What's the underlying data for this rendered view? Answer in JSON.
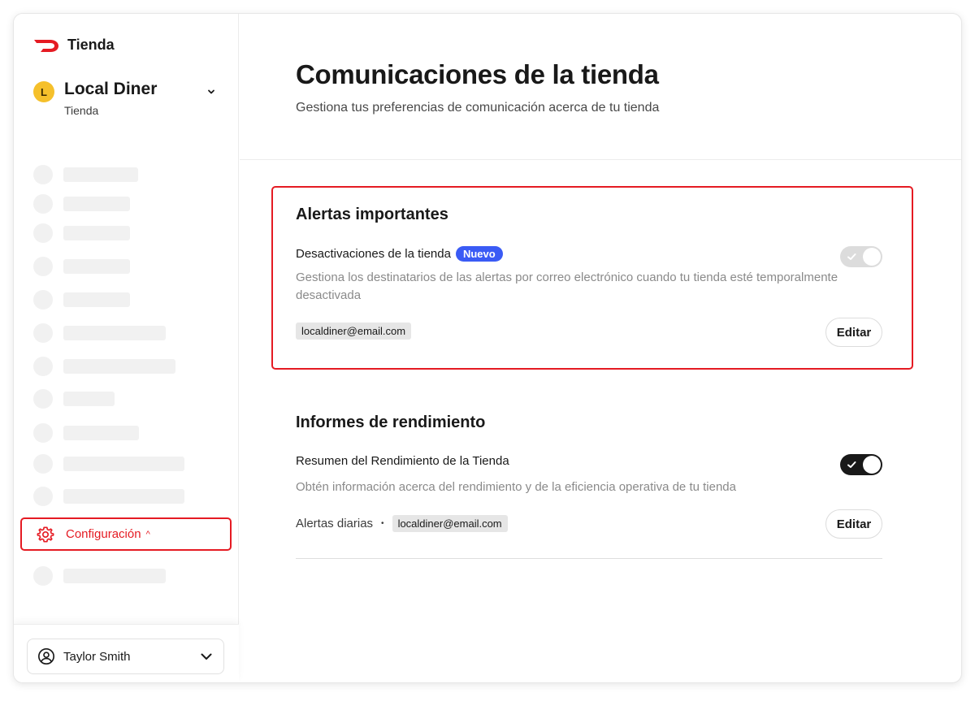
{
  "sidebar": {
    "brand": "Tienda",
    "store": {
      "avatar_letter": "L",
      "name": "Local Diner",
      "type": "Tienda"
    },
    "config_item": {
      "label": "Configuración",
      "caret": "^"
    },
    "user": {
      "name": "Taylor Smith"
    }
  },
  "page": {
    "title": "Comunicaciones de la tienda",
    "subtitle": "Gestiona tus preferencias de comunicación acerca de tu tienda"
  },
  "sections": {
    "alerts": {
      "title": "Alertas importantes",
      "item_title": "Desactivaciones de la tienda",
      "badge": "Nuevo",
      "description": "Gestiona los destinatarios de las alertas por correo electrónico cuando tu tienda esté temporalmente desactivada",
      "email": "localdiner@email.com",
      "edit_label": "Editar"
    },
    "reports": {
      "title": "Informes de rendimiento",
      "item_title": "Resumen del Rendimiento de la Tienda",
      "description": "Obtén información acerca del rendimiento y de la eficiencia operativa de tu tienda",
      "frequency": "Alertas diarias",
      "separator": "•",
      "email": "localdiner@email.com",
      "edit_label": "Editar"
    }
  },
  "colors": {
    "brand_red": "#e51b23",
    "badge_blue": "#3a5bf5",
    "avatar_yellow": "#f5c02b"
  }
}
